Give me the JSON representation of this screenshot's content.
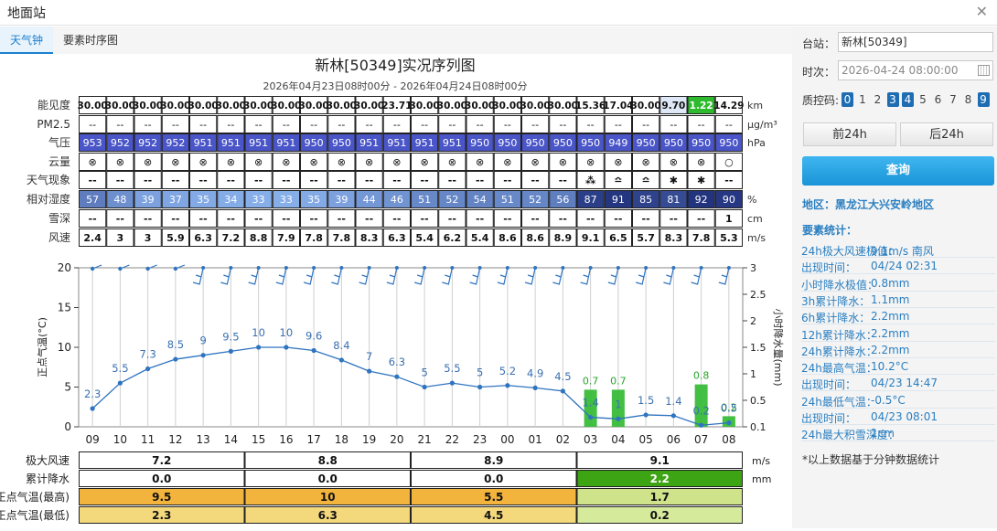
{
  "window": {
    "title": "地面站"
  },
  "tabs": [
    "天气钟",
    "要素时序图"
  ],
  "chart": {
    "title": "新林[50349]实况序列图",
    "subtitle": "2026年04月23日08时00分 - 2026年04月24日08时00分",
    "hours": [
      "09",
      "10",
      "11",
      "12",
      "13",
      "14",
      "15",
      "16",
      "17",
      "18",
      "19",
      "20",
      "21",
      "22",
      "23",
      "00",
      "01",
      "02",
      "03",
      "04",
      "05",
      "06",
      "07",
      "08"
    ],
    "rows": [
      {
        "label": "能见度",
        "unit": "km",
        "values": [
          "30.00",
          "30.00",
          "30.00",
          "30.00",
          "30.00",
          "30.00",
          "30.00",
          "30.00",
          "30.00",
          "30.00",
          "30.00",
          "23.71",
          "30.00",
          "30.00",
          "30.00",
          "30.00",
          "30.00",
          "30.00",
          "15.36",
          "17.04",
          "30.00",
          "9.70",
          "1.22",
          "14.29"
        ]
      },
      {
        "label": "PM2.5",
        "unit": "μg/m³",
        "values": [
          "--",
          "--",
          "--",
          "--",
          "--",
          "--",
          "--",
          "--",
          "--",
          "--",
          "--",
          "--",
          "--",
          "--",
          "--",
          "--",
          "--",
          "--",
          "--",
          "--",
          "--",
          "--",
          "--",
          "--"
        ]
      },
      {
        "label": "气压",
        "unit": "hPa",
        "values": [
          "953",
          "952",
          "952",
          "952",
          "951",
          "951",
          "951",
          "951",
          "950",
          "950",
          "951",
          "951",
          "951",
          "951",
          "950",
          "950",
          "950",
          "950",
          "950",
          "949",
          "950",
          "950",
          "950",
          "950"
        ]
      },
      {
        "label": "云量",
        "unit": "",
        "values": [
          "⊗",
          "⊗",
          "⊗",
          "⊗",
          "⊗",
          "⊗",
          "⊗",
          "⊗",
          "⊗",
          "⊗",
          "⊗",
          "⊗",
          "⊗",
          "⊗",
          "⊗",
          "⊗",
          "⊗",
          "⊗",
          "⊗",
          "⊗",
          "⊗",
          "⊗",
          "⊗",
          "○"
        ]
      },
      {
        "label": "天气现象",
        "unit": "",
        "values": [
          "--",
          "--",
          "--",
          "--",
          "--",
          "--",
          "--",
          "--",
          "--",
          "--",
          "--",
          "--",
          "--",
          "--",
          "--",
          "--",
          "--",
          "--",
          "⁂",
          "≏",
          "≏",
          "✱",
          "✱",
          "--"
        ]
      },
      {
        "label": "相对湿度",
        "unit": "%",
        "values": [
          "57",
          "48",
          "39",
          "37",
          "35",
          "34",
          "33",
          "33",
          "35",
          "39",
          "44",
          "46",
          "51",
          "52",
          "54",
          "51",
          "52",
          "56",
          "87",
          "91",
          "85",
          "81",
          "92",
          "90"
        ]
      },
      {
        "label": "雪深",
        "unit": "cm",
        "values": [
          "--",
          "--",
          "--",
          "--",
          "--",
          "--",
          "--",
          "--",
          "--",
          "--",
          "--",
          "--",
          "--",
          "--",
          "--",
          "--",
          "--",
          "--",
          "--",
          "--",
          "--",
          "--",
          "--",
          "1"
        ]
      },
      {
        "label": "风速",
        "unit": "m/s",
        "values": [
          "2.4",
          "3",
          "3",
          "5.9",
          "6.3",
          "7.2",
          "8.8",
          "7.9",
          "7.8",
          "7.8",
          "8.3",
          "6.3",
          "5.4",
          "6.2",
          "5.4",
          "8.6",
          "8.6",
          "8.9",
          "9.1",
          "6.5",
          "5.7",
          "8.3",
          "7.8",
          "5.3"
        ]
      }
    ],
    "ylabel_left": "正点气温(°C)",
    "ylabel_right": "小时降水量(mm)",
    "y_left_ticks": [
      "20",
      "15",
      "10",
      "5",
      "0"
    ],
    "y_right_ticks": [
      "3",
      "2.5",
      "2",
      "1.5",
      "1",
      "0.5",
      "0.1"
    ],
    "bottom_rows": [
      {
        "label": "极大风速",
        "unit": "m/s",
        "values": [
          "7.2",
          "8.8",
          "8.9",
          "9.1"
        ]
      },
      {
        "label": "累计降水",
        "unit": "mm",
        "values": [
          "0.0",
          "0.0",
          "0.0",
          "2.2"
        ]
      },
      {
        "label": "正点气温(最高)",
        "unit": "",
        "values": [
          "9.5",
          "10",
          "5.5",
          "1.7"
        ]
      },
      {
        "label": "正点气温(最低)",
        "unit": "",
        "values": [
          "2.3",
          "6.3",
          "4.5",
          "0.2"
        ]
      }
    ]
  },
  "chart_data": {
    "type": "line",
    "categories": [
      "09",
      "10",
      "11",
      "12",
      "13",
      "14",
      "15",
      "16",
      "17",
      "18",
      "19",
      "20",
      "21",
      "22",
      "23",
      "00",
      "01",
      "02",
      "03",
      "04",
      "05",
      "06",
      "07",
      "08"
    ],
    "series": [
      {
        "name": "正点气温(°C)",
        "values": [
          2.3,
          5.5,
          7.3,
          8.5,
          9,
          9.5,
          10,
          10,
          9.6,
          8.4,
          7,
          6.3,
          5,
          5.5,
          5,
          5.2,
          4.9,
          4.5,
          1.2,
          1,
          1.5,
          1.4,
          0.2,
          0.5
        ],
        "labels": [
          "2.3",
          "5.5",
          "7.3",
          "8.5",
          "9",
          "9.5",
          "10",
          "10",
          "9.6",
          "8.4",
          "7",
          "6.3",
          "5",
          "5.5",
          "5",
          "5.2",
          "4.9",
          "4.5",
          "1.4",
          "1",
          "1.5",
          "1.4",
          "0.2",
          "0.5"
        ]
      },
      {
        "name": "小时降水量(mm)",
        "type": "bar",
        "values": [
          0,
          0,
          0,
          0,
          0,
          0,
          0,
          0,
          0,
          0,
          0,
          0,
          0,
          0,
          0,
          0,
          0,
          0,
          0.7,
          0.7,
          0,
          0,
          0.8,
          0.2
        ],
        "labels": [
          "",
          "",
          "",
          "",
          "",
          "",
          "",
          "",
          "",
          "",
          "",
          "",
          "",
          "",
          "",
          "",
          "",
          "",
          "0.7",
          "0.7",
          "",
          "",
          "0.8",
          "0.2"
        ]
      }
    ],
    "ylim": [
      0,
      20
    ],
    "y2lim": [
      0,
      3
    ]
  },
  "sidebar": {
    "station_label": "台站：",
    "station_value": "新林[50349]",
    "time_label": "时次：",
    "time_value": "2026-04-24 08:00:00",
    "qc_label": "质控码:",
    "qc_codes": [
      "0",
      "1",
      "2",
      "3",
      "4",
      "5",
      "6",
      "7",
      "8",
      "9"
    ],
    "prev_button": "前24h",
    "next_button": "后24h",
    "query_button": "查询",
    "region": "地区：黑龙江大兴安岭地区",
    "stats_title": "要素统计：",
    "stats": [
      {
        "k": "24h极大风速极值：",
        "v": "9.1m/s 南风"
      },
      {
        "k": "出现时间：",
        "v": "04/24 02:31"
      },
      {
        "k": "小时降水极值：",
        "v": "0.8mm"
      },
      {
        "k": "3h累计降水：",
        "v": "1.1mm"
      },
      {
        "k": "6h累计降水：",
        "v": "2.2mm"
      },
      {
        "k": "12h累计降水：",
        "v": "2.2mm"
      },
      {
        "k": "24h累计降水：",
        "v": "2.2mm"
      },
      {
        "k": "24h最高气温：",
        "v": "10.2°C"
      },
      {
        "k": "出现时间：",
        "v": "04/23 14:47"
      },
      {
        "k": "24h最低气温：",
        "v": "-0.5°C"
      },
      {
        "k": "出现时间：",
        "v": "04/23 08:01"
      },
      {
        "k": "24h最大积雪深度：",
        "v": "1cm"
      }
    ],
    "footnote": "*以上数据基于分钟数据统计"
  },
  "colors": {
    "accent": "#1a7fd0",
    "pressure_bg": "#4a55c8",
    "rh_low": "#8ab4ee",
    "rh_high": "#1e2e7a",
    "vis_highlight": "#2dbb2d",
    "precip_total": "#3da413",
    "tmax": "#f2b43c",
    "tmin": "#f4d87c",
    "temp_line": "#2f74c0"
  }
}
